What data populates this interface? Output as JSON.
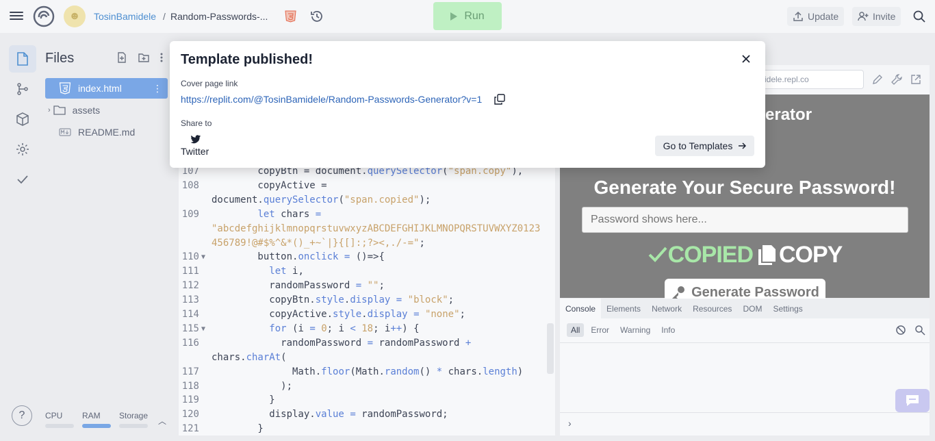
{
  "topbar": {
    "user": "TosinBamidele",
    "separator": "/",
    "repl_name": "Random-Passwords-...",
    "run_label": "Run",
    "update_label": "Update",
    "invite_label": "Invite"
  },
  "files": {
    "title": "Files",
    "items": [
      {
        "name": "index.html",
        "icon": "html5-icon"
      },
      {
        "name": "assets",
        "icon": "folder-icon"
      },
      {
        "name": "README.md",
        "icon": "markdown-icon"
      }
    ]
  },
  "usage": {
    "cpu": "CPU",
    "ram": "RAM",
    "storage": "Storage"
  },
  "editor": {
    "lines": [
      {
        "n": "107",
        "fold": "",
        "html": "        copyBtn = document.<span class='op'>querySelector</span>(<span class='str'>\"span.copy\"</span>),"
      },
      {
        "n": "108",
        "fold": "",
        "html": "        copyActive ="
      },
      {
        "n": "",
        "fold": "",
        "html": "document.<span class='op'>querySelector</span>(<span class='str'>\"span.copied\"</span>);"
      },
      {
        "n": "109",
        "fold": "",
        "html": "        <span class='kw'>let</span> chars <span class='op'>=</span>"
      },
      {
        "n": "",
        "fold": "",
        "html": "<span class='str'>\"abcdefghijklmnopqrstuvwxyzABCDEFGHIJKLMNOPQRSTUVWXYZ0123</span>"
      },
      {
        "n": "",
        "fold": "",
        "html": "<span class='str'>456789!@#$%^&amp;*()_+~`|}{[]:;?&gt;&lt;,./-=\"</span>;"
      },
      {
        "n": "110",
        "fold": "▼",
        "html": "        button.<span class='op'>onclick</span> <span class='op'>=</span> ()=&gt;{"
      },
      {
        "n": "111",
        "fold": "",
        "html": "          <span class='kw'>let</span> i,"
      },
      {
        "n": "112",
        "fold": "",
        "html": "          randomPassword <span class='op'>=</span> <span class='str'>\"\"</span>;"
      },
      {
        "n": "113",
        "fold": "",
        "html": "          copyBtn.<span class='op'>style</span>.<span class='op'>display</span> <span class='op'>=</span> <span class='str'>\"block\"</span>;"
      },
      {
        "n": "114",
        "fold": "",
        "html": "          copyActive.<span class='op'>style</span>.<span class='op'>display</span> <span class='op'>=</span> <span class='str'>\"none\"</span>;"
      },
      {
        "n": "115",
        "fold": "▼",
        "html": "          <span class='kw'>for</span> (i <span class='op'>=</span> <span class='str'>0</span>; i <span class='op'>&lt;</span> <span class='str'>18</span>; i<span class='op'>++</span>) {"
      },
      {
        "n": "116",
        "fold": "",
        "html": "            randomPassword <span class='op'>=</span> randomPassword <span class='op'>+</span>"
      },
      {
        "n": "",
        "fold": "",
        "html": "chars.<span class='op'>charAt</span>("
      },
      {
        "n": "117",
        "fold": "",
        "html": "              Math.<span class='op'>floor</span>(Math.<span class='op'>random</span>() <span class='op'>*</span> chars.<span class='op'>length</span>)"
      },
      {
        "n": "118",
        "fold": "",
        "html": "            );"
      },
      {
        "n": "119",
        "fold": "",
        "html": "          }"
      },
      {
        "n": "120",
        "fold": "",
        "html": "          display.<span class='op'>value</span> <span class='op'>=</span> randomPassword;"
      },
      {
        "n": "121",
        "fold": "",
        "html": "        }"
      }
    ]
  },
  "preview": {
    "url": "idele.repl.co",
    "heading_top": "enerator",
    "heading": "Generate Your Secure Password!",
    "input_placeholder": "Password shows here...",
    "copied_label": "COPIED",
    "copy_label": "COPY",
    "generate_label": "Generate Password"
  },
  "devtools": {
    "tabs": [
      "Console",
      "Elements",
      "Network",
      "Resources",
      "DOM",
      "Settings"
    ],
    "filters": [
      "All",
      "Error",
      "Warning",
      "Info"
    ],
    "prompt": "›"
  },
  "modal": {
    "title": "Template published!",
    "cover_label": "Cover page link",
    "cover_link": "https://replit.com/@TosinBamidele/Random-Passwords-Generator?v=1",
    "share_label": "Share to",
    "twitter_label": "Twitter",
    "go_templates_label": "Go to Templates",
    "help_label": "?"
  }
}
